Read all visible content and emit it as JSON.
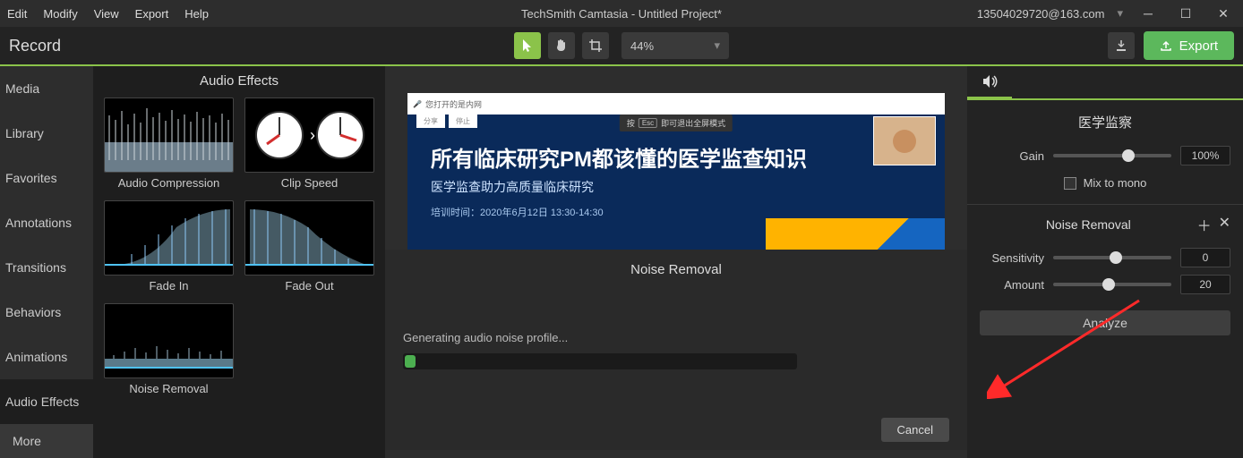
{
  "menu": {
    "edit": "Edit",
    "modify": "Modify",
    "view": "View",
    "export": "Export",
    "help": "Help"
  },
  "title": "TechSmith Camtasia - Untitled Project*",
  "account": "13504029720@163.com",
  "toolbar": {
    "record": "Record",
    "zoom": "44%",
    "export": "Export"
  },
  "sidebar": {
    "items": [
      "Media",
      "Library",
      "Favorites",
      "Annotations",
      "Transitions",
      "Behaviors",
      "Animations",
      "Audio Effects"
    ],
    "more": "More",
    "active_index": 7
  },
  "effects": {
    "title": "Audio Effects",
    "cards": [
      "Audio Compression",
      "Clip Speed",
      "Fade In",
      "Fade Out",
      "Noise Removal"
    ]
  },
  "preview": {
    "topbar_text": "您打开的是内网",
    "esc_prefix": "按",
    "esc_key": "Esc",
    "esc_suffix": "即可退出全屏模式",
    "btn1": "分享",
    "btn2": "停止",
    "slide_title": "所有临床研究PM都该懂的医学监查知识",
    "slide_sub": "医学监查助力高质量临床研究",
    "slide_meta": "培训时间：2020年6月12日  13:30-14:30"
  },
  "modal": {
    "title": "Noise Removal",
    "status": "Generating audio noise profile...",
    "cancel": "Cancel"
  },
  "props": {
    "section1_title": "医学监察",
    "gain_label": "Gain",
    "gain_value": "100%",
    "mix_label": "Mix to mono",
    "section2_title": "Noise Removal",
    "sensitivity_label": "Sensitivity",
    "sensitivity_value": "0",
    "amount_label": "Amount",
    "amount_value": "20",
    "analyze": "Analyze"
  }
}
